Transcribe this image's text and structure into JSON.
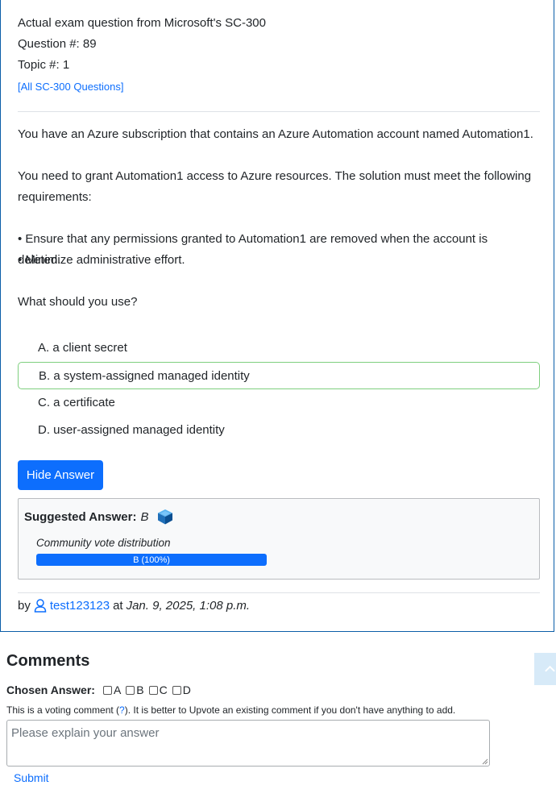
{
  "exam": {
    "title": "Actual exam question from Microsoft's SC-300",
    "question_no": "Question #: 89",
    "topic_no": "Topic #: 1",
    "all_questions_link": "[All SC-300 Questions]"
  },
  "question": {
    "p1": "You have an Azure subscription that contains an Azure Automation account named Automation1.",
    "p2": "You need to grant Automation1 access to Azure resources. The solution must meet the following requirements:",
    "b1": "• Ensure that any permissions granted to Automation1 are removed when the account is deleted.",
    "b2": "• Minimize administrative effort.",
    "p3": "What should you use?"
  },
  "choices": [
    {
      "label": "A. a client secret"
    },
    {
      "label": "B. a system-assigned managed identity"
    },
    {
      "label": "C. a certificate"
    },
    {
      "label": "D. user-assigned managed identity"
    }
  ],
  "answer": {
    "hide_button": "Hide Answer",
    "suggested_label": "Suggested Answer:",
    "suggested_value": "B",
    "vote_title": "Community vote distribution",
    "vote_bar_label": "B (100%)",
    "vote_fraction": 1.0,
    "cube_icon": "answer-cube-icon"
  },
  "byline": {
    "by": "by",
    "user": "test123123",
    "at": "at",
    "date": "Jan. 9, 2025, 1:08 p.m."
  },
  "comments": {
    "heading": "Comments",
    "chosen_label": "Chosen Answer:",
    "options": [
      "A",
      "B",
      "C",
      "D"
    ],
    "note_pre": "This is a voting comment (",
    "note_q": "?",
    "note_post": "). It is better to Upvote an existing comment if you don't have anything to add.",
    "placeholder": "Please explain your answer",
    "submit": "Submit"
  },
  "colors": {
    "accent": "#0d6efd",
    "correct_border": "#7fcf7f",
    "card_border": "#0b5ea8"
  }
}
